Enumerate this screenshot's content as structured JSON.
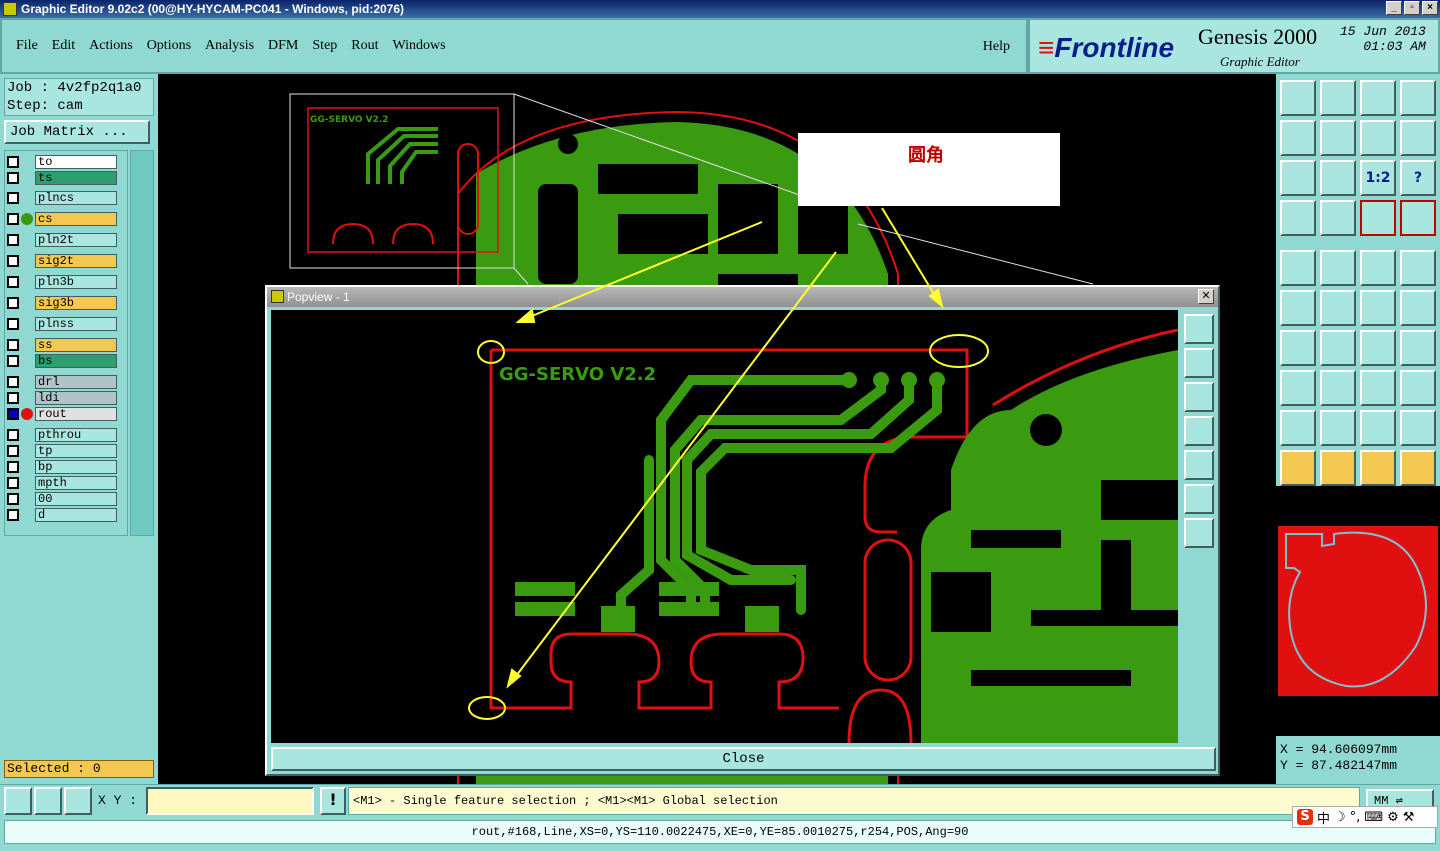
{
  "window": {
    "title": "Graphic Editor 9.02c2 (00@HY-HYCAM-PC041 - Windows, pid:2076)"
  },
  "menu": [
    "File",
    "Edit",
    "Actions",
    "Options",
    "Analysis",
    "DFM",
    "Step",
    "Rout",
    "Windows"
  ],
  "help_label": "Help",
  "brand": {
    "logo": "Frontline",
    "product": "Genesis 2000",
    "subtitle": "Graphic Editor",
    "date": "15 Jun 2013",
    "time": "01:03 AM"
  },
  "job": {
    "job_line": "Job : 4v2fp2q1a0",
    "step_line": "Step: cam",
    "matrix_button": "Job Matrix ..."
  },
  "layers": [
    {
      "name": "to",
      "color": "#ffffff"
    },
    {
      "name": "ts",
      "color": "#2e9e6e"
    },
    {
      "name": "plncs",
      "color": "#a9e6df"
    },
    {
      "name": "cs",
      "color": "#f4c850",
      "active": true
    },
    {
      "name": "pln2t",
      "color": "#a9e6df"
    },
    {
      "name": "sig2t",
      "color": "#f4c850"
    },
    {
      "name": "pln3b",
      "color": "#a9e6df"
    },
    {
      "name": "sig3b",
      "color": "#f4c850"
    },
    {
      "name": "plnss",
      "color": "#a9e6df"
    },
    {
      "name": "ss",
      "color": "#f4c850"
    },
    {
      "name": "bs",
      "color": "#2e9e6e"
    },
    {
      "name": "drl",
      "color": "#b0c4c8"
    },
    {
      "name": "ldi",
      "color": "#b0c4c8"
    },
    {
      "name": "rout",
      "color": "#e0e0e0",
      "work": true
    },
    {
      "name": "pthrou",
      "color": "#a9e6df"
    },
    {
      "name": "tp",
      "color": "#a9e6df"
    },
    {
      "name": "bp",
      "color": "#a9e6df"
    },
    {
      "name": "mpth",
      "color": "#a9e6df"
    },
    {
      "name": "00",
      "color": "#a9e6df"
    },
    {
      "name": "d",
      "color": "#a9e6df"
    }
  ],
  "selected_text": "Selected : 0",
  "callout_text": "圆角",
  "popview": {
    "title": "Popview - 1",
    "close_label": "Close",
    "board_text": "GG-SERVO V2.2",
    "mini_text": "GG-SERVO V2.2"
  },
  "coords": {
    "x": "X =  94.606097mm",
    "y": "Y =  87.482147mm"
  },
  "xy_label": "X Y :",
  "xy_value": "",
  "hint": "<M1> - Single feature selection ; <M1><M1> Global selection",
  "units": "MM",
  "status": "rout,#168,Line,XS=0,YS=110.0022475,XE=0,YE=85.0010275,r254,POS,Ang=90",
  "ime_chars": [
    "中",
    "☽",
    "°,",
    "⌨",
    "⚙",
    "⚒"
  ],
  "ime_logo": "S",
  "right_tool_labels": [
    "1:2",
    "?"
  ],
  "colors": {
    "copper": "#3a9a10",
    "rout": "#e01010",
    "panel": "#8fd9d2",
    "highlight": "#f4c850",
    "annotation": "#ffff30"
  }
}
